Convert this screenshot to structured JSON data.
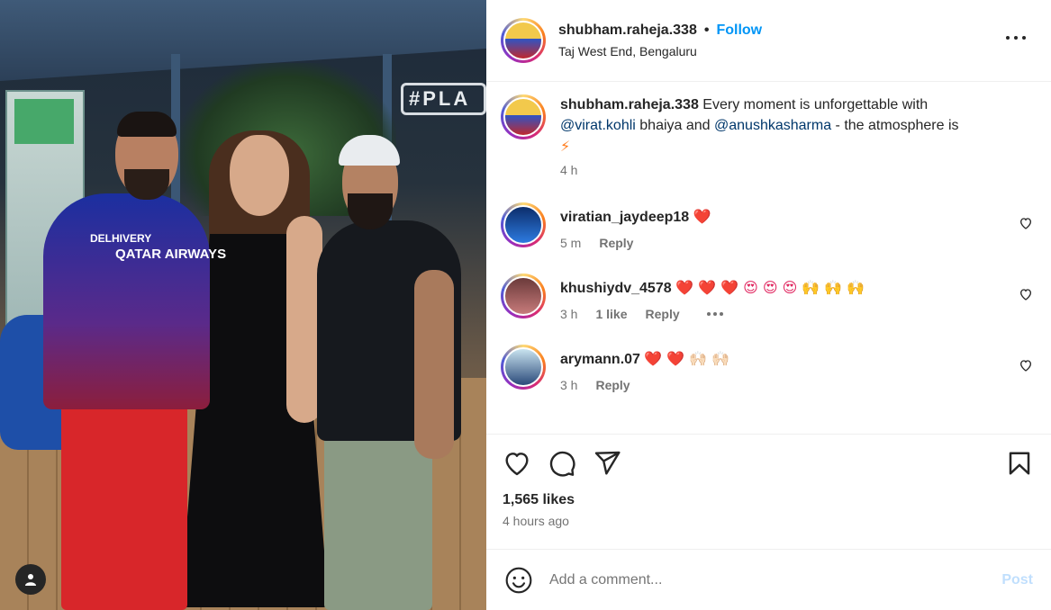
{
  "post": {
    "author": "shubham.raheja.338",
    "separator": "•",
    "follow_label": "Follow",
    "location": "Taj West End, Bengaluru",
    "photo": {
      "sign_text": "#PLA",
      "jersey_sponsor_line1": "DELHIVERY",
      "jersey_sponsor_line2": "QATAR AIRWAYS"
    }
  },
  "caption": {
    "username": "shubham.raheja.338",
    "text_part1": " Every moment is unforgettable with ",
    "mention1": "@virat.kohli",
    "text_part2": " bhaiya and ",
    "mention2": "@anushkasharma",
    "text_part3": " - the atmosphere is",
    "emoji": "⚡",
    "time": "4 h"
  },
  "comments": [
    {
      "username": "viratian_jaydeep18",
      "text": "❤️",
      "time": "5 m",
      "likes": "",
      "reply_label": "Reply",
      "has_more": false
    },
    {
      "username": "khushiydv_4578",
      "text": "❤️ ❤️ ❤️ 😍 😍 😍 🙌 🙌 🙌",
      "time": "3 h",
      "likes": "1 like",
      "reply_label": "Reply",
      "has_more": true
    },
    {
      "username": "arymann.07",
      "text": "❤️ ❤️ 🙌🏻 🙌🏻",
      "time": "3 h",
      "likes": "",
      "reply_label": "Reply",
      "has_more": false
    }
  ],
  "actions": {
    "likes_count": "1,565 likes",
    "time_ago": "4 hours ago"
  },
  "add_comment": {
    "placeholder": "Add a comment...",
    "post_label": "Post"
  },
  "icons": [
    "more-icon",
    "heart-icon",
    "comment-icon",
    "share-icon",
    "bookmark-icon",
    "emoji-icon",
    "user-tag-icon"
  ],
  "colors": {
    "link": "#0095f6",
    "mention": "#00376b",
    "muted": "#737373",
    "post_disabled": "#c0dffd"
  }
}
